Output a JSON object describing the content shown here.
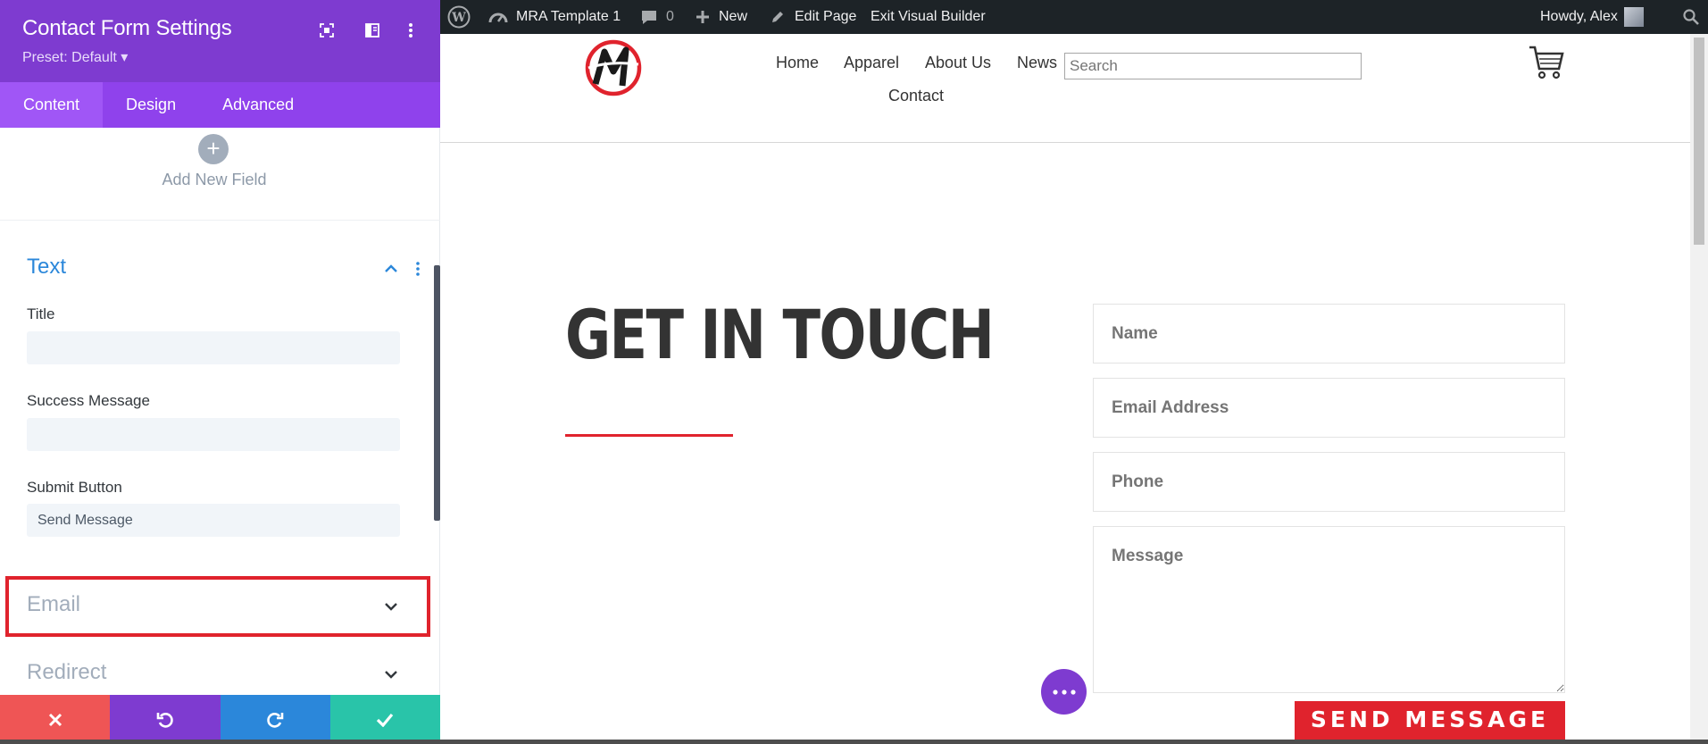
{
  "panel": {
    "title": "Contact Form Settings",
    "preset": "Preset: Default ▾",
    "header_icons": [
      "expand-icon",
      "sidebar-toggle-icon",
      "more-vertical-icon"
    ],
    "tabs": [
      {
        "label": "Content",
        "active": true
      },
      {
        "label": "Design",
        "active": false
      },
      {
        "label": "Advanced",
        "active": false
      }
    ],
    "add_field": {
      "icon": "+",
      "label": "Add New Field"
    },
    "text_section": {
      "title": "Text",
      "fields": [
        {
          "label": "Title",
          "value": ""
        },
        {
          "label": "Success Message",
          "value": ""
        },
        {
          "label": "Submit Button",
          "value": "Send Message"
        }
      ]
    },
    "collapsed_sections": [
      {
        "title": "Email",
        "highlighted": true
      },
      {
        "title": "Redirect",
        "highlighted": false
      }
    ],
    "bottom_bar": [
      {
        "name": "discard",
        "icon": "close-icon",
        "color": "#ef5555"
      },
      {
        "name": "undo",
        "icon": "undo-icon",
        "color": "#7e3bd0"
      },
      {
        "name": "redo",
        "icon": "redo-icon",
        "color": "#2b87da"
      },
      {
        "name": "save",
        "icon": "check-icon",
        "color": "#29c4a9"
      }
    ]
  },
  "admin_bar": {
    "site_name": "MRA Template 1",
    "comments_count": "0",
    "new_label": "New",
    "edit_label": "Edit Page",
    "exit_label": "Exit Visual Builder",
    "howdy": "Howdy, Alex"
  },
  "site": {
    "nav": [
      "Home",
      "Apparel",
      "About Us",
      "News",
      "Contact"
    ],
    "search_placeholder": "Search",
    "heading": "GET IN TOUCH",
    "form": {
      "name_placeholder": "Name",
      "email_placeholder": "Email Address",
      "phone_placeholder": "Phone",
      "message_placeholder": "Message",
      "button_label": "SEND MESSAGE"
    }
  },
  "colors": {
    "panel_purple": "#7e3bd0",
    "tab_purple": "#8f42ec",
    "accent_blue": "#2b87da",
    "brand_red": "#e0232d",
    "admin_bar": "#1d2327"
  }
}
